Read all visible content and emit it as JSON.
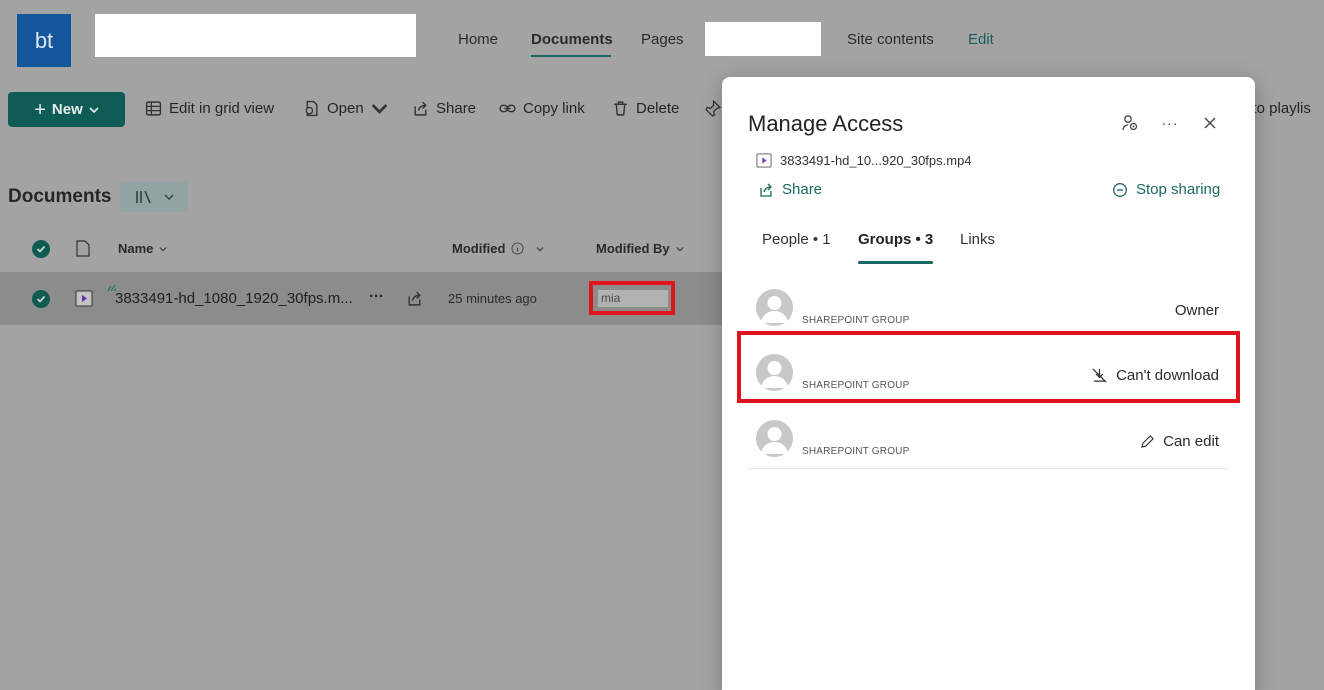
{
  "site": {
    "logo_text": "bt",
    "nav": [
      {
        "label": "Home"
      },
      {
        "label": "Documents"
      },
      {
        "label": "Pages"
      },
      {
        "label": "Site contents"
      },
      {
        "label": "Edit"
      }
    ]
  },
  "commandbar": {
    "new_label": "New",
    "edit_grid": "Edit in grid view",
    "open": "Open",
    "share": "Share",
    "copy_link": "Copy link",
    "delete": "Delete",
    "add_playlist": "d to playlis"
  },
  "library": {
    "title": "Documents",
    "columns": {
      "name": "Name",
      "modified": "Modified",
      "modified_by": "Modified By"
    },
    "rows": [
      {
        "name": "3833491-hd_1080_1920_30fps.m...",
        "more": "···",
        "modified": "25 minutes ago",
        "modified_by": "mia"
      }
    ]
  },
  "panel": {
    "title": "Manage Access",
    "file_name": "3833491-hd_10...920_30fps.mp4",
    "share_label": "Share",
    "stop_sharing_label": "Stop sharing",
    "tabs": [
      {
        "label": "People • 1"
      },
      {
        "label": "Groups • 3"
      },
      {
        "label": "Links"
      }
    ],
    "members": [
      {
        "subtitle": "SHAREPOINT GROUP",
        "role": "Owner"
      },
      {
        "subtitle": "SHAREPOINT GROUP",
        "role": "Can't download"
      },
      {
        "subtitle": "SHAREPOINT GROUP",
        "role": "Can edit"
      }
    ]
  },
  "colors": {
    "accent": "#0e5c55",
    "highlight": "#e0141c",
    "logo": "#14569c"
  }
}
